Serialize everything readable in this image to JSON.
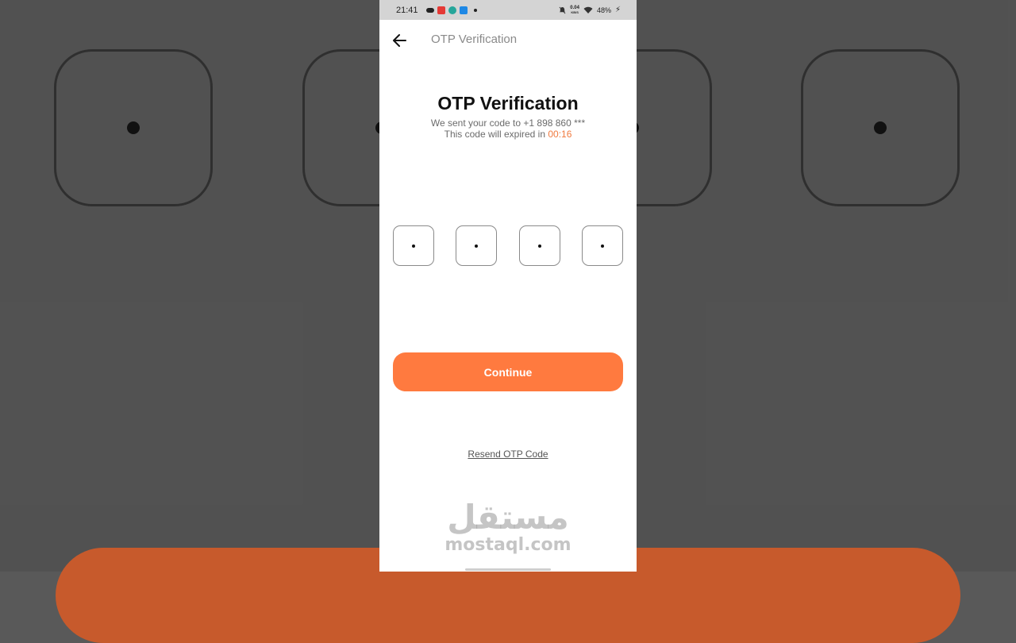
{
  "status_bar": {
    "time": "21:41",
    "speed_value": "0.04",
    "speed_unit": "KB/S",
    "battery": "48%"
  },
  "header": {
    "title": "OTP Verification",
    "back_icon": "arrow-left-icon"
  },
  "main": {
    "heading": "OTP Verification",
    "sent_text": "We sent your code to +1 898 860 ***",
    "expire_text": "This code will expired in",
    "timer": "00:16",
    "otp_digits": [
      "",
      "",
      "",
      ""
    ],
    "continue_label": "Continue",
    "resend_label": "Resend OTP Code"
  },
  "watermark": {
    "arabic": "مستقل",
    "latin": "mostaql.com"
  },
  "colors": {
    "accent": "#ff7a3f",
    "timer": "#f07a3f",
    "background": "#595959"
  }
}
